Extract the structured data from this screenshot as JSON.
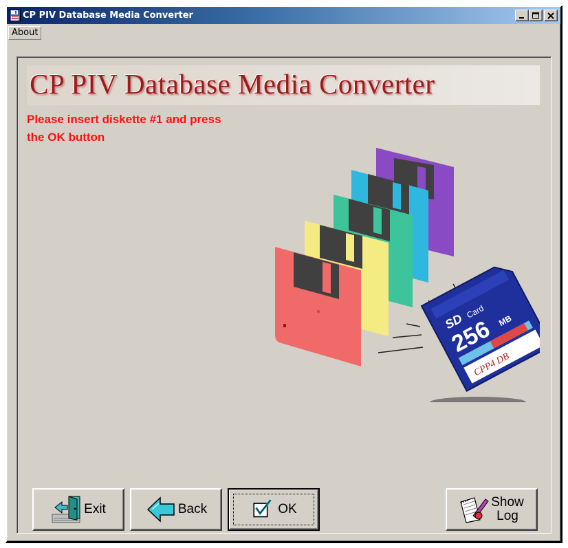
{
  "window": {
    "title": "CP PIV Database Media Converter",
    "minimize_icon": "minimize-icon",
    "maximize_icon": "maximize-icon",
    "close_icon": "close-icon",
    "title_gradient_start": "#0a246a",
    "title_gradient_end": "#a6caf0"
  },
  "menu": {
    "items": [
      "About"
    ]
  },
  "banner": {
    "title": "CP PIV Database Media Converter",
    "color": "#9c1c1c"
  },
  "instruction": {
    "line1": "Please insert diskette #1 and press",
    "line2": "the OK button",
    "color": "#ff1010"
  },
  "illustration": {
    "sd_card": {
      "brand": "SD",
      "label": "Card",
      "capacity": "256",
      "unit": "MB",
      "tag": "CPP4 DB"
    },
    "diskette_colors": [
      "#f06a6a",
      "#f4ec82",
      "#3ec49a",
      "#2fb8df",
      "#8c4cc4"
    ]
  },
  "buttons": {
    "exit": "Exit",
    "back": "Back",
    "ok": "OK",
    "show_log": "Show\nLog"
  }
}
